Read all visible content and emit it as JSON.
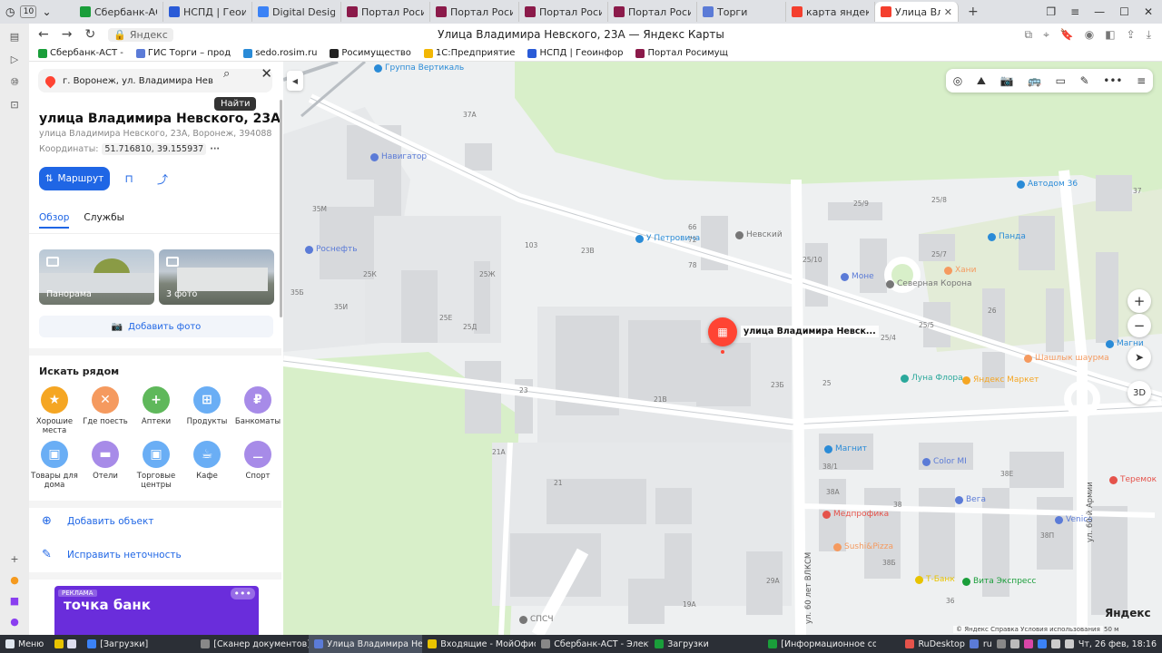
{
  "browser": {
    "tab_count": "10",
    "tabs": [
      {
        "label": "Сбербанк-АСТ -",
        "color": "#1a9e3a"
      },
      {
        "label": "НСПД | Геоинфо",
        "color": "#2a5bd7"
      },
      {
        "label": "Digital Design W",
        "color": "#3b82f6"
      },
      {
        "label": "Портал Росиму",
        "color": "#8b1a4a"
      },
      {
        "label": "Портал Росиму",
        "color": "#8b1a4a"
      },
      {
        "label": "Портал Росиму",
        "color": "#8b1a4a"
      },
      {
        "label": "Портал Росиму",
        "color": "#8b1a4a"
      },
      {
        "label": "Торги",
        "color": "#5b7bd7"
      },
      {
        "label": "карта яндекс —",
        "color": "#f43f2e"
      },
      {
        "label": "Улица Владим",
        "color": "#f43f2e"
      }
    ],
    "address_pill": "Яндекс",
    "page_title": "Улица Владимира Невского, 23А — Яндекс Карты",
    "bookmarks": [
      {
        "label": "Сбербанк-АСТ -",
        "color": "#1a9e3a"
      },
      {
        "label": "ГИС Торги – прод",
        "color": "#5b7bd7"
      },
      {
        "label": "sedo.rosim.ru",
        "color": "#2a8bd7"
      },
      {
        "label": "Росимущество",
        "color": "#222222"
      },
      {
        "label": "1С:Предприятие",
        "color": "#f2b705"
      },
      {
        "label": "НСПД | Геоинфор",
        "color": "#2a5bd7"
      },
      {
        "label": "Портал Росимущ",
        "color": "#8b1a4a"
      }
    ]
  },
  "panel": {
    "search_value": "г. Воронеж, ул. Владимира Невского",
    "search_tooltip": "Найти",
    "title": "улица Владимира Невского, 23А",
    "address": "улица Владимира Невского, 23А, Воронеж, 394088",
    "coords_label": "Координаты:",
    "coords_value": "51.716810, 39.155937",
    "route_label": "Маршрут",
    "tabs": [
      "Обзор",
      "Службы"
    ],
    "photos": [
      {
        "caption": "Панорама"
      },
      {
        "caption": "3 фото"
      }
    ],
    "add_photo": "Добавить фото",
    "nearby_title": "Искать рядом",
    "categories": [
      {
        "label": "Хорошие места",
        "color": "#f5a623",
        "glyph": "★"
      },
      {
        "label": "Где поесть",
        "color": "#f59a5f",
        "glyph": "✕"
      },
      {
        "label": "Аптеки",
        "color": "#5fb85b",
        "glyph": "+"
      },
      {
        "label": "Продукты",
        "color": "#6aaef5",
        "glyph": "⊞"
      },
      {
        "label": "Банкоматы",
        "color": "#a78be8",
        "glyph": "₽"
      },
      {
        "label": "Товары для дома",
        "color": "#6aaef5",
        "glyph": "▣"
      },
      {
        "label": "Отели",
        "color": "#a78be8",
        "glyph": "▬"
      },
      {
        "label": "Торговые центры",
        "color": "#6aaef5",
        "glyph": "▣"
      },
      {
        "label": "Кафе",
        "color": "#6aaef5",
        "glyph": "☕"
      },
      {
        "label": "Спорт",
        "color": "#a78be8",
        "glyph": "⚊"
      }
    ],
    "add_object": "Добавить объект",
    "fix_error": "Исправить неточность",
    "ad_tag": "РЕКЛАМА",
    "ad_name": "точка банк"
  },
  "map": {
    "marker_label": "улица Владимира Невск...",
    "pois": [
      {
        "label": "Группа Вертикаль",
        "color": "#2a8bd7"
      },
      {
        "label": "Навигатор",
        "color": "#5b7bd7"
      },
      {
        "label": "Роснефть",
        "color": "#5b7bd7"
      },
      {
        "label": "У Петровича",
        "color": "#2a8bd7"
      },
      {
        "label": "Невский",
        "color": "#777777"
      },
      {
        "label": "Моне",
        "color": "#5b7bd7"
      },
      {
        "label": "Северная Корона",
        "color": "#777777"
      },
      {
        "label": "Хани",
        "color": "#f59a5f"
      },
      {
        "label": "Панда",
        "color": "#2a8bd7"
      },
      {
        "label": "Автодом 36",
        "color": "#2a8bd7"
      },
      {
        "label": "Луна Флора",
        "color": "#2aa89b"
      },
      {
        "label": "Яндекс Маркет",
        "color": "#f5a623"
      },
      {
        "label": "Шашлык шаурма",
        "color": "#f59a5f"
      },
      {
        "label": "Магнит",
        "color": "#2a8bd7"
      },
      {
        "label": "Color MI",
        "color": "#5b7bd7"
      },
      {
        "label": "Вега",
        "color": "#5b7bd7"
      },
      {
        "label": "Медпрофика",
        "color": "#e5534b"
      },
      {
        "label": "Venice",
        "color": "#5b7bd7"
      },
      {
        "label": "Sushi&Pizza",
        "color": "#f59a5f"
      },
      {
        "label": "Т-Банк",
        "color": "#e8c300"
      },
      {
        "label": "Вита Экспресс",
        "color": "#1a9e3a"
      },
      {
        "label": "СПСЧ",
        "color": "#777777"
      },
      {
        "label": "Магни",
        "color": "#2a8bd7"
      },
      {
        "label": "Теремок",
        "color": "#e5534b"
      }
    ],
    "street_labels": [
      "ул. 60-й Армии",
      "ул. 60 лет ВЛКСМ"
    ],
    "house_numbers": [
      "37А",
      "35М",
      "25К",
      "25Ж",
      "35Б",
      "35И",
      "25Е",
      "25Д",
      "23В",
      "23",
      "21В",
      "21А",
      "21",
      "23Б",
      "66",
      "72",
      "78",
      "103",
      "25/9",
      "25/8",
      "25/10",
      "25/7",
      "25/5",
      "25/4",
      "25",
      "26",
      "37",
      "38/1",
      "38А",
      "38",
      "38Б",
      "38Е",
      "38П",
      "36",
      "29А",
      "19А"
    ],
    "yandex_logo": "Яндекс",
    "attribution": "© Яндекс  Справка  Условия использования",
    "scale": "50 м",
    "zoom_in": "+",
    "zoom_out": "−",
    "btn_3d": "3D"
  },
  "taskbar": {
    "start": "Меню",
    "items": [
      {
        "label": "[Загрузки]",
        "color": "#3b82f6"
      },
      {
        "label": "[Сканер документов]",
        "color": "#888888"
      },
      {
        "label": "Улица Владимира Невск...",
        "color": "#5b7bd7"
      },
      {
        "label": "Входящие - МойОфис По...",
        "color": "#e8c300"
      },
      {
        "label": "Сбербанк-АСТ - Электро...",
        "color": "#888888"
      },
      {
        "label": "Загрузки",
        "color": "#1a9e3a"
      },
      {
        "label": "[Информационное сооб...",
        "color": "#1a9e3a"
      }
    ],
    "rudesktop": "RuDesktop",
    "lang": "ru",
    "clock": "Чт, 26 фев, 18:16"
  }
}
